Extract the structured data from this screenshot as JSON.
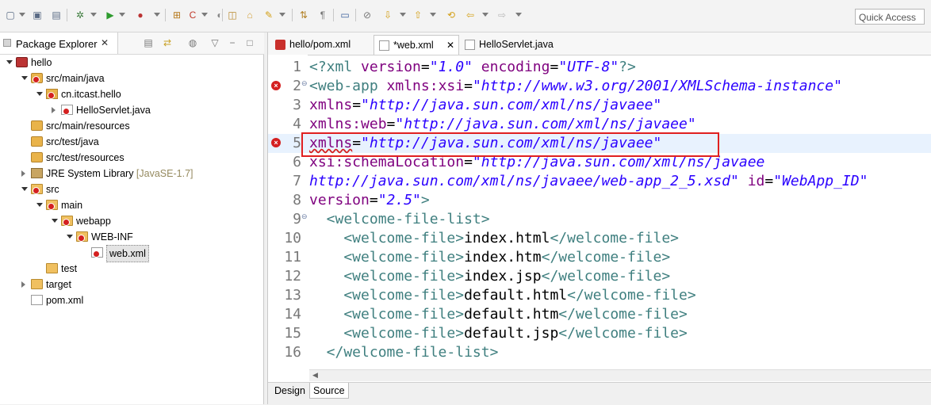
{
  "toolbar": {
    "quick_access": "Quick Access"
  },
  "package_explorer": {
    "title": "Package Explorer",
    "close": "✕",
    "tree": [
      {
        "label": "hello",
        "level": 0,
        "expanded": true,
        "icon": "project-icon",
        "error": false
      },
      {
        "label": "src/main/java",
        "level": 1,
        "expanded": true,
        "icon": "source-folder-icon",
        "error": true
      },
      {
        "label": "cn.itcast.hello",
        "level": 2,
        "expanded": true,
        "icon": "package-icon",
        "error": true
      },
      {
        "label": "HelloServlet.java",
        "level": 3,
        "expanded": false,
        "icon": "java-file-icon",
        "error": true
      },
      {
        "label": "src/main/resources",
        "level": 1,
        "expanded": null,
        "icon": "source-folder-icon",
        "error": false
      },
      {
        "label": "src/test/java",
        "level": 1,
        "expanded": null,
        "icon": "source-folder-icon",
        "error": false
      },
      {
        "label": "src/test/resources",
        "level": 1,
        "expanded": null,
        "icon": "source-folder-icon",
        "error": false
      },
      {
        "label": "JRE System Library",
        "extra": "[JavaSE-1.7]",
        "level": 1,
        "expanded": false,
        "icon": "library-icon",
        "error": false
      },
      {
        "label": "src",
        "level": 1,
        "expanded": true,
        "icon": "folder-icon",
        "error": true
      },
      {
        "label": "main",
        "level": 2,
        "expanded": true,
        "icon": "folder-icon",
        "error": true
      },
      {
        "label": "webapp",
        "level": 3,
        "expanded": true,
        "icon": "folder-icon",
        "error": true
      },
      {
        "label": "WEB-INF",
        "level": 4,
        "expanded": true,
        "icon": "folder-icon",
        "error": true
      },
      {
        "label": "web.xml",
        "level": 5,
        "expanded": null,
        "icon": "xml-file-icon",
        "error": true,
        "selected": true
      },
      {
        "label": "test",
        "level": 2,
        "expanded": null,
        "icon": "folder-icon",
        "error": false
      },
      {
        "label": "target",
        "level": 1,
        "expanded": false,
        "icon": "folder-icon",
        "error": false
      },
      {
        "label": "pom.xml",
        "level": 1,
        "expanded": null,
        "icon": "xml-file-icon",
        "error": false
      }
    ]
  },
  "editor": {
    "tabs": [
      {
        "label": "hello/pom.xml",
        "active": false,
        "icon": "maven-icon"
      },
      {
        "label": "*web.xml",
        "active": true,
        "icon": "xml-error-icon",
        "close": "✕"
      },
      {
        "label": "HelloServlet.java",
        "active": false,
        "icon": "java-file-icon"
      }
    ],
    "lines": [
      {
        "n": "1",
        "err": false,
        "fold": false
      },
      {
        "n": "2",
        "err": true,
        "fold": true
      },
      {
        "n": "3",
        "err": false,
        "fold": false
      },
      {
        "n": "4",
        "err": false,
        "fold": false
      },
      {
        "n": "5",
        "err": true,
        "fold": false,
        "highlight": true
      },
      {
        "n": "6",
        "err": false,
        "fold": false
      },
      {
        "n": "7",
        "err": false,
        "fold": false
      },
      {
        "n": "8",
        "err": false,
        "fold": false
      },
      {
        "n": "9",
        "err": false,
        "fold": true
      },
      {
        "n": "10",
        "err": false,
        "fold": false
      },
      {
        "n": "11",
        "err": false,
        "fold": false
      },
      {
        "n": "12",
        "err": false,
        "fold": false
      },
      {
        "n": "13",
        "err": false,
        "fold": false
      },
      {
        "n": "14",
        "err": false,
        "fold": false
      },
      {
        "n": "15",
        "err": false,
        "fold": false
      },
      {
        "n": "16",
        "err": false,
        "fold": false
      }
    ],
    "code": {
      "l1": [
        "<?xml ",
        "version",
        "=",
        "\"1.0\"",
        " ",
        "encoding",
        "=",
        "\"UTF-8\"",
        "?>"
      ],
      "l2": [
        "<web-app",
        " ",
        "xmlns:xsi",
        "=",
        "\"http://www.w3.org/2001/XMLSchema-instance\""
      ],
      "l3": [
        "xmlns",
        "=",
        "\"http://java.sun.com/xml/ns/javaee\""
      ],
      "l4": [
        "xmlns:web",
        "=",
        "\"http://java.sun.com/xml/ns/javaee\""
      ],
      "l5": [
        "xmlns",
        "=",
        "\"http://java.sun.com/xml/ns/javaee\""
      ],
      "l6": [
        "xsi:schemaLocation",
        "=",
        "\"http://java.sun.com/xml/ns/javaee"
      ],
      "l7": [
        "http://java.sun.com/xml/ns/javaee/web-app_2_5.xsd\"",
        " ",
        "id",
        "=",
        "\"WebApp_ID\""
      ],
      "l8": [
        "version",
        "=",
        "\"2.5\"",
        ">"
      ],
      "l9": [
        "  <welcome-file-list>"
      ],
      "l10": [
        "    <welcome-file>",
        "index.html",
        "</welcome-file>"
      ],
      "l11": [
        "    <welcome-file>",
        "index.htm",
        "</welcome-file>"
      ],
      "l12": [
        "    <welcome-file>",
        "index.jsp",
        "</welcome-file>"
      ],
      "l13": [
        "    <welcome-file>",
        "default.html",
        "</welcome-file>"
      ],
      "l14": [
        "    <welcome-file>",
        "default.htm",
        "</welcome-file>"
      ],
      "l15": [
        "    <welcome-file>",
        "default.jsp",
        "</welcome-file>"
      ],
      "l16": [
        "  </welcome-file-list>"
      ]
    },
    "bottom_tabs": {
      "design": "Design",
      "source": "Source"
    }
  },
  "colors": {
    "tag": "#3f7f7f",
    "attr": "#7f007f",
    "value": "#2a00ff",
    "error": "#d42020",
    "highlight_box": "#e02020"
  }
}
